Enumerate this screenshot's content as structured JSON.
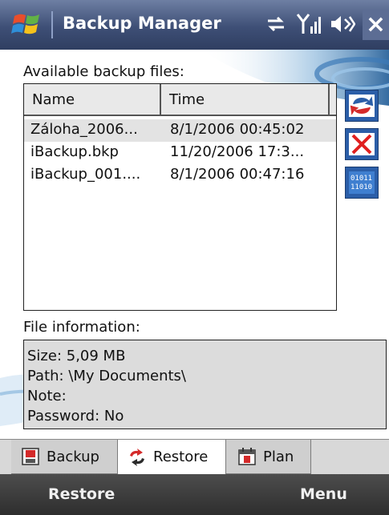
{
  "title_bar": {
    "app_title": "Backup Manager",
    "status_icons": [
      "connectivity-icon",
      "signal-strength-icon",
      "speaker-icon"
    ],
    "close_label": "×"
  },
  "main": {
    "files_label": "Available backup files:",
    "columns": [
      "Name",
      "Time"
    ],
    "files": [
      {
        "name": "Záloha_2006...",
        "time": "8/1/2006 00:45:02",
        "selected": true
      },
      {
        "name": "iBackup.bkp",
        "time": "11/20/2006 17:3...",
        "selected": false
      },
      {
        "name": "iBackup_001....",
        "time": "8/1/2006 00:47:16",
        "selected": false
      }
    ],
    "side_buttons": [
      "refresh-icon",
      "delete-icon",
      "binary-data-icon"
    ],
    "info_label": "File information:",
    "info": {
      "size": "Size: 5,09 MB",
      "path": "Path: \\My Documents\\",
      "note": "Note:",
      "password": "Password: No"
    }
  },
  "tabs": [
    {
      "label": "Backup",
      "icon": "backup-icon",
      "active": false
    },
    {
      "label": "Restore",
      "icon": "restore-icon",
      "active": true
    },
    {
      "label": "Plan",
      "icon": "calendar-icon",
      "active": false
    }
  ],
  "softkeys": {
    "left": "Restore",
    "right": "Menu"
  },
  "colors": {
    "title_bar": "#3e4f76",
    "selection": "#e3e3e3",
    "side_button": "#2b5ea8",
    "softkey_bar": "#3a3a3a"
  }
}
